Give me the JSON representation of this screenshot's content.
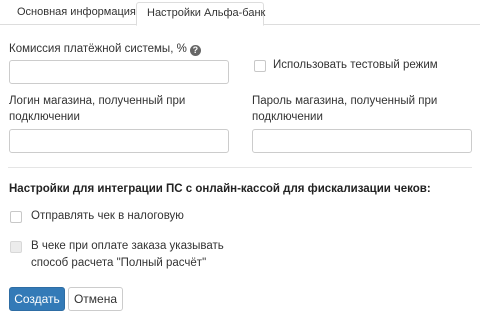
{
  "tabs": [
    {
      "label": "Основная информация",
      "active": false
    },
    {
      "label": "Настройки Альфа-банк",
      "active": true
    }
  ],
  "form": {
    "commission": {
      "label": "Комиссия платёжной системы, %",
      "help_icon": "question-circle-icon",
      "value": ""
    },
    "test_mode": {
      "label": "Использовать тестовый режим",
      "checked": false
    },
    "login": {
      "label_line1": "Логин магазина, полученный при",
      "label_line2": "подключении",
      "value": ""
    },
    "password": {
      "label_line1": "Пароль магазина, полученный при",
      "label_line2": "подключении",
      "value": ""
    }
  },
  "fiscal": {
    "title": "Настройки для интеграции ПС с онлайн-кассой для фискализации чеков:",
    "send_to_tax": {
      "label": "Отправлять чек в налоговую",
      "checked": false
    },
    "full_payment": {
      "label_line1": "В чеке при оплате заказа указывать",
      "label_line2": "способ расчета \"Полный расчёт\"",
      "checked": false,
      "disabled": true
    }
  },
  "buttons": {
    "create": "Создать",
    "cancel": "Отмена"
  },
  "colors": {
    "primary": "#337ab7",
    "border": "#cccccc"
  }
}
